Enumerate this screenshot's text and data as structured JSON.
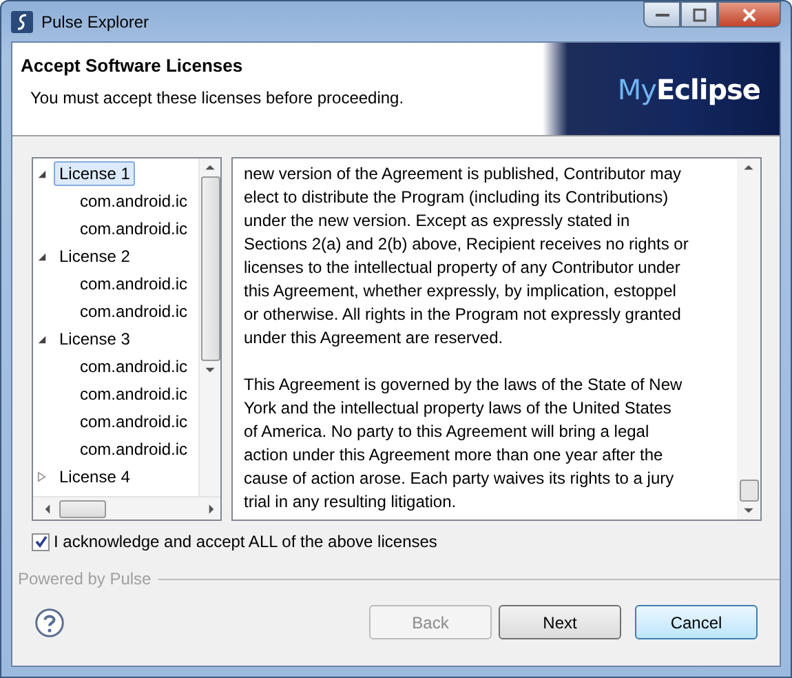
{
  "window": {
    "title": "Pulse Explorer"
  },
  "header": {
    "title": "Accept Software Licenses",
    "subtitle": "You must accept these licenses before proceeding.",
    "logo": {
      "first": "My",
      "second": "Eclipse"
    }
  },
  "tree": [
    {
      "label": "License 1",
      "expanded": true,
      "selected": true,
      "children": [
        {
          "label": "com.android.ic"
        },
        {
          "label": "com.android.ic"
        }
      ]
    },
    {
      "label": "License 2",
      "expanded": true,
      "selected": false,
      "children": [
        {
          "label": "com.android.ic"
        },
        {
          "label": "com.android.ic"
        }
      ]
    },
    {
      "label": "License 3",
      "expanded": true,
      "selected": false,
      "children": [
        {
          "label": "com.android.ic"
        },
        {
          "label": "com.android.ic"
        },
        {
          "label": "com.android.ic"
        },
        {
          "label": "com.android.ic"
        }
      ]
    },
    {
      "label": "License 4",
      "expanded": false,
      "selected": false
    }
  ],
  "license_text": [
    [
      "new version of the Agreement is published, Contributor may",
      "elect to distribute the Program (including its Contributions)",
      "under the new version. Except as expressly stated in",
      "Sections 2(a) and 2(b) above, Recipient receives no rights or",
      "licenses to the intellectual property of any Contributor under",
      "this Agreement, whether expressly, by implication, estoppel",
      "or otherwise. All rights in the Program not expressly granted",
      "under this Agreement are reserved."
    ],
    [
      "This Agreement is governed by the laws of the State of New",
      "York and the intellectual property laws of the United States",
      "of America. No party to this Agreement will bring a legal",
      "action under this Agreement more than one year after the",
      "cause of action arose. Each party waives its rights to a jury",
      "trial in any resulting litigation."
    ]
  ],
  "accept": {
    "label": "I acknowledge and accept ALL of the above licenses",
    "checked": true
  },
  "footer": {
    "powered_by": "Powered by Pulse"
  },
  "buttons": [
    {
      "label": "Back",
      "disabled": true,
      "default": false
    },
    {
      "label": "Next",
      "disabled": false,
      "default": false
    },
    {
      "label": "Cancel",
      "disabled": false,
      "default": true
    }
  ]
}
